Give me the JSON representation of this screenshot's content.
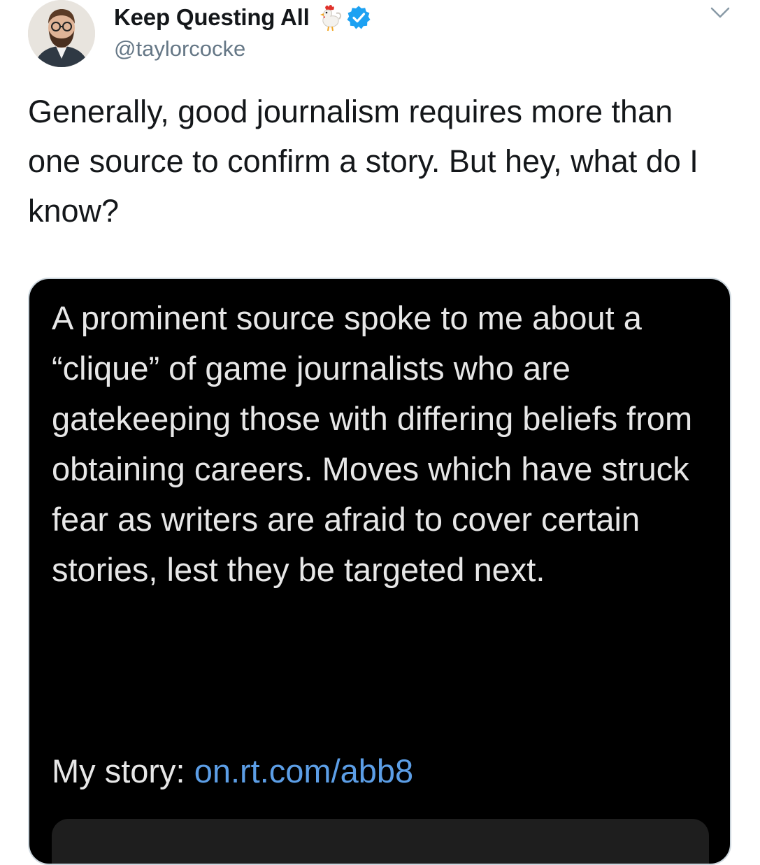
{
  "tweet": {
    "display_name": "Keep Questing All",
    "handle": "@taylorcocke",
    "name_emoji": "rooster-emoji",
    "verified_icon": "verified-badge-icon",
    "menu_icon": "chevron-down-icon",
    "text": "Generally, good journalism requires more than one source to confirm a story. But hey, what do I know?"
  },
  "media": {
    "body": "A prominent source spoke to me about a “clique” of game journalists who are gatekeeping those with differing beliefs from obtaining careers. Moves which have struck fear as writers are afraid to cover certain stories, lest they be targeted next.",
    "story_label": "My story: ",
    "story_link": "on.rt.com/abb8"
  },
  "colors": {
    "primary_text": "#14171a",
    "secondary_text": "#657786",
    "verified_blue": "#1da1f2",
    "media_background": "#000000",
    "media_text": "#e7e7e7",
    "media_link": "#5c9ee6"
  }
}
